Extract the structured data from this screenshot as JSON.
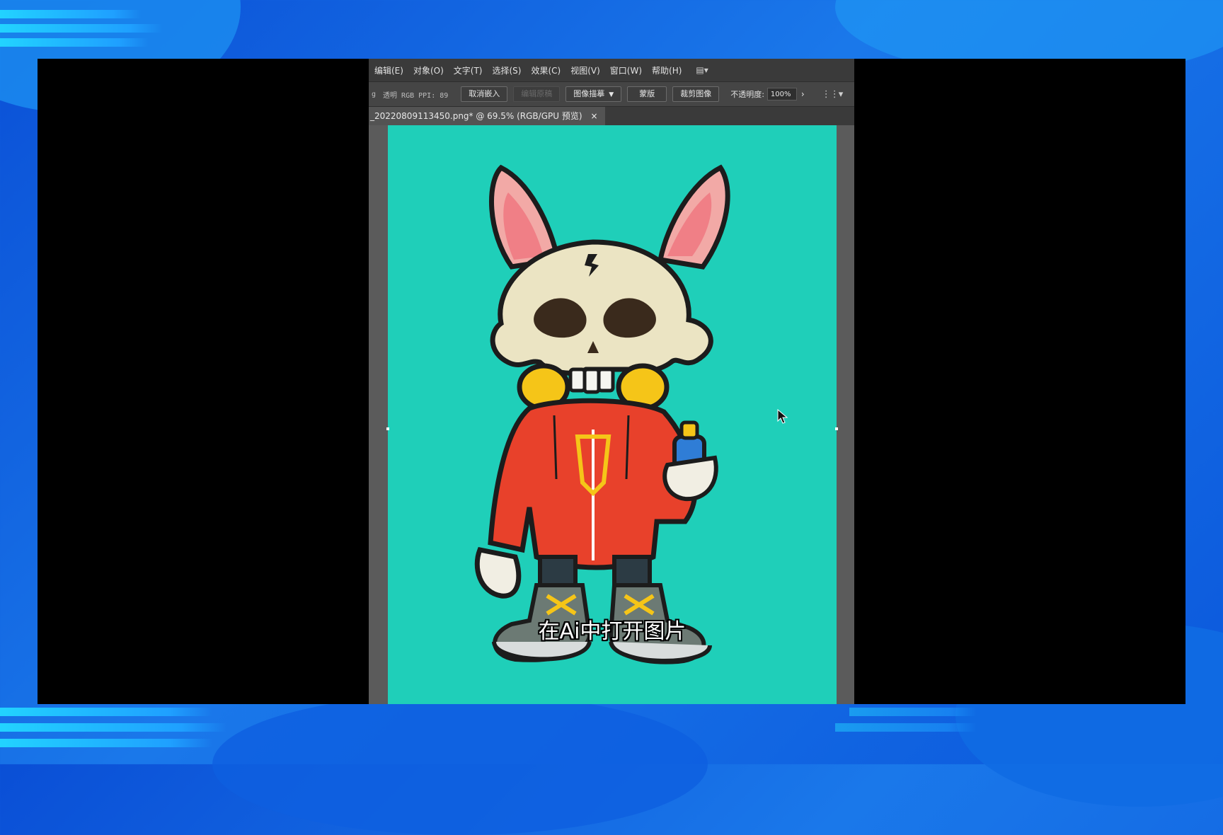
{
  "menu": {
    "items": [
      "编辑(E)",
      "对象(O)",
      "文字(T)",
      "选择(S)",
      "效果(C)",
      "视图(V)",
      "窗口(W)",
      "帮助(H)"
    ],
    "workspace_icon": "▤▾"
  },
  "control_bar": {
    "left_marker": "g",
    "mode_text": "透明 RGB PPI: 89",
    "unembed_button": "取消嵌入",
    "edit_original_button": "编辑原稿",
    "image_trace_button": "图像描摹",
    "mask_button": "蒙版",
    "crop_button": "裁剪图像",
    "opacity_label": "不透明度:",
    "opacity_value": "100%",
    "chevron": "›",
    "grid_icon": "⋮⋮▾"
  },
  "document_tab": {
    "title": "_20220809113450.png* @ 69.5% (RGB/GPU 预览)",
    "close": "×"
  },
  "artwork": {
    "description_icon": "skull-bunny-character-illustration",
    "background_color": "#1fcfb9"
  },
  "subtitle": "在Ai中打开图片",
  "colors": {
    "artboard": "#1fcfb9",
    "hoodie": "#e8412b",
    "skull": "#ebe4c3",
    "headphones": "#f5c518"
  }
}
